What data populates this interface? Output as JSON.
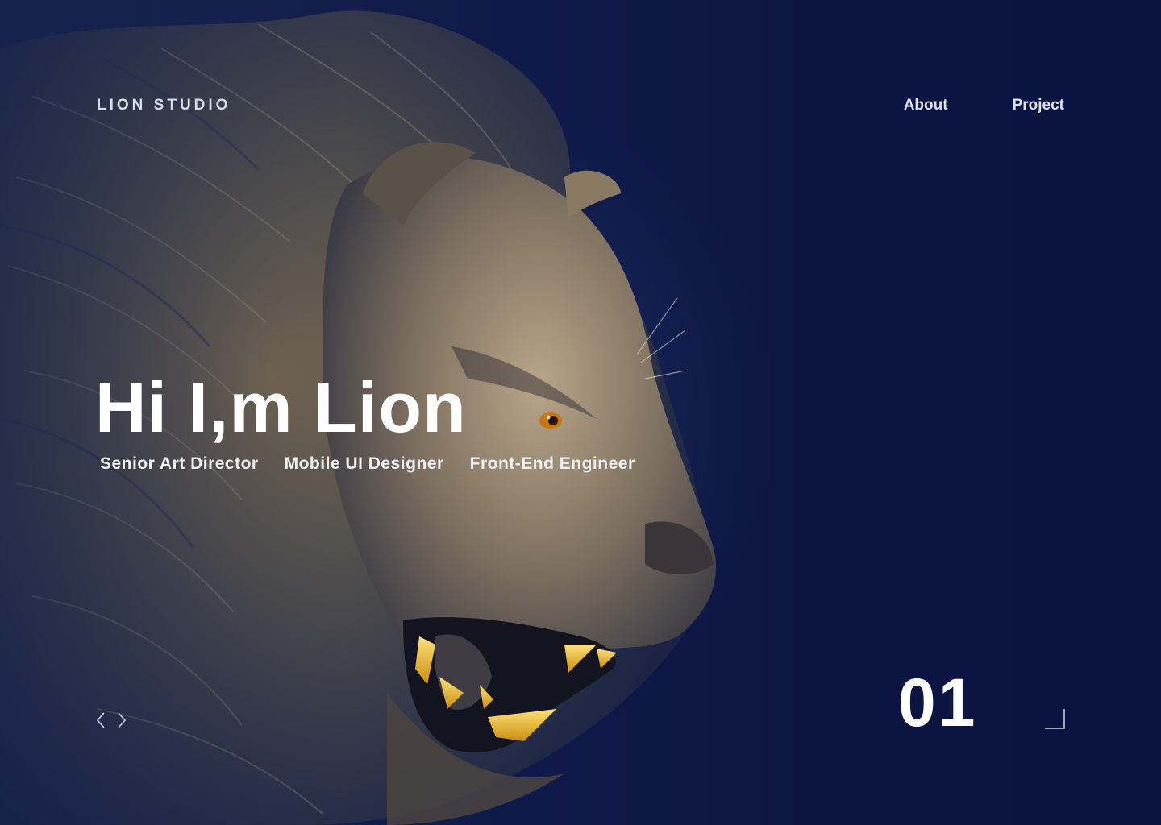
{
  "brand": {
    "name": "LION STUDIO"
  },
  "nav": {
    "items": [
      {
        "label": "About"
      },
      {
        "label": "Project"
      }
    ]
  },
  "hero": {
    "headline": "Hi I,m Lion",
    "roles": [
      "Senior Art Director",
      "Mobile UI Designer",
      "Front-End Engineer"
    ],
    "image_subject": "roaring lion head in profile"
  },
  "slider": {
    "current": "01"
  },
  "icons": {
    "prev": "chevron-left-icon",
    "next": "chevron-right-icon",
    "corner": "corner-bracket-icon"
  },
  "colors": {
    "background": "#0b1340",
    "text": "#ffffff",
    "nav_text": "#dfe2ee",
    "lion_fur": "#a8926f",
    "lion_teeth": "#e6b21c"
  }
}
